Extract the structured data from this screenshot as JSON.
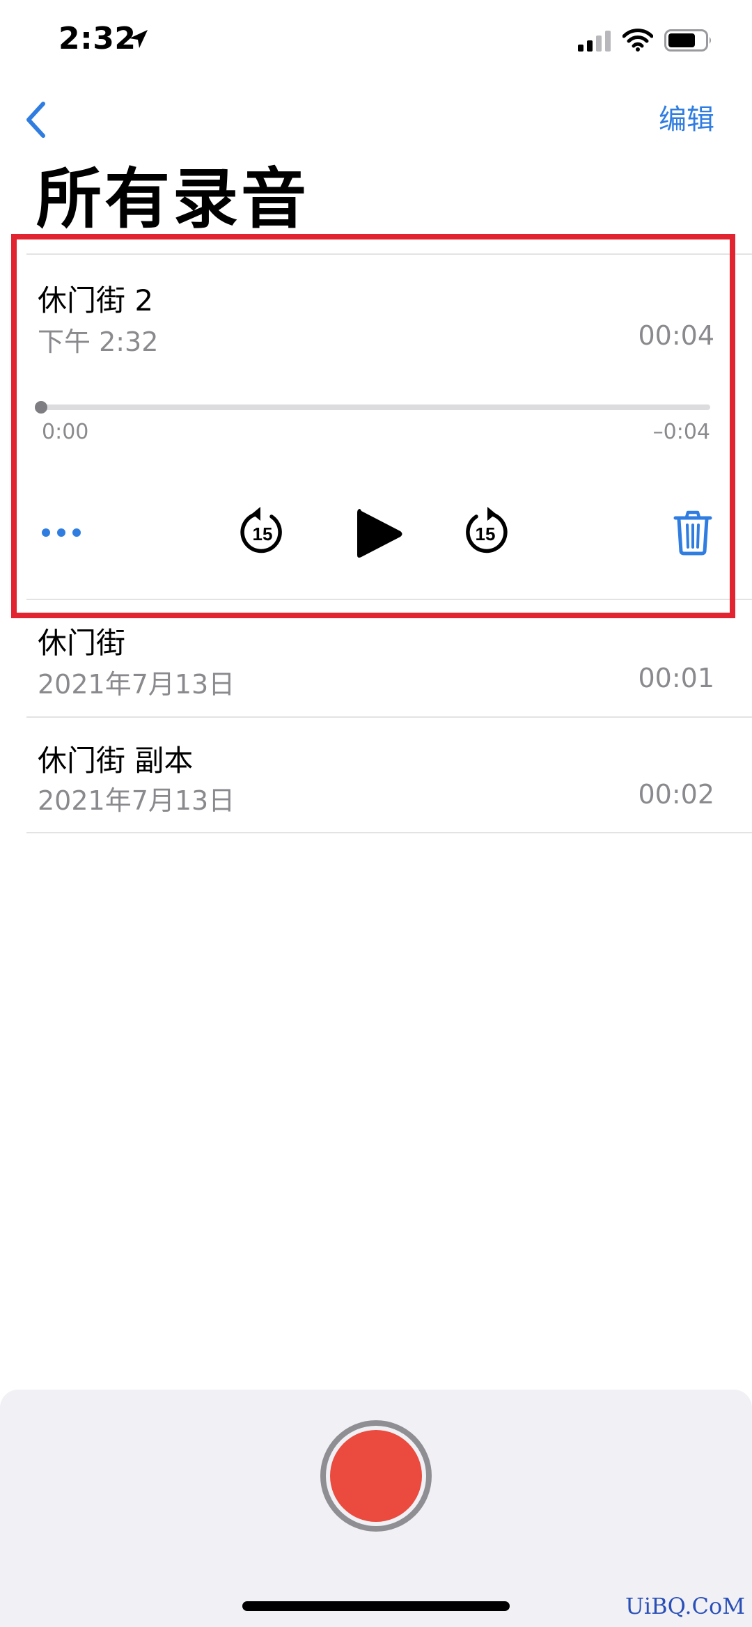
{
  "status_bar": {
    "time": "2:32",
    "icons": [
      "location-arrow-icon",
      "cellular-signal-icon",
      "wifi-icon",
      "battery-icon"
    ]
  },
  "nav": {
    "back_icon": "chevron-left-icon",
    "edit_label": "编辑"
  },
  "page_title": "所有录音",
  "selected_recording": {
    "title": "休门街 2",
    "date": "下午 2:32",
    "duration": "00:04",
    "elapsed": "0:00",
    "remaining": "–0:04",
    "progress": 0.0,
    "controls": {
      "more_icon": "more-dots-icon",
      "skip_back_icon": "skip-back-15-icon",
      "skip_back_label": "15",
      "play_icon": "play-icon",
      "skip_forward_icon": "skip-forward-15-icon",
      "skip_forward_label": "15",
      "delete_icon": "trash-icon"
    }
  },
  "recordings": [
    {
      "title": "休门街",
      "date": "2021年7月13日",
      "duration": "00:01"
    },
    {
      "title": "休门街 副本",
      "date": "2021年7月13日",
      "duration": "00:02"
    }
  ],
  "record_button_icon": "record-icon",
  "watermark": "UiBQ.CoM",
  "colors": {
    "accent": "#2f7de1",
    "record": "#ea4b3e",
    "highlight": "#e1242f",
    "secondary_text": "#8a8a8e"
  }
}
